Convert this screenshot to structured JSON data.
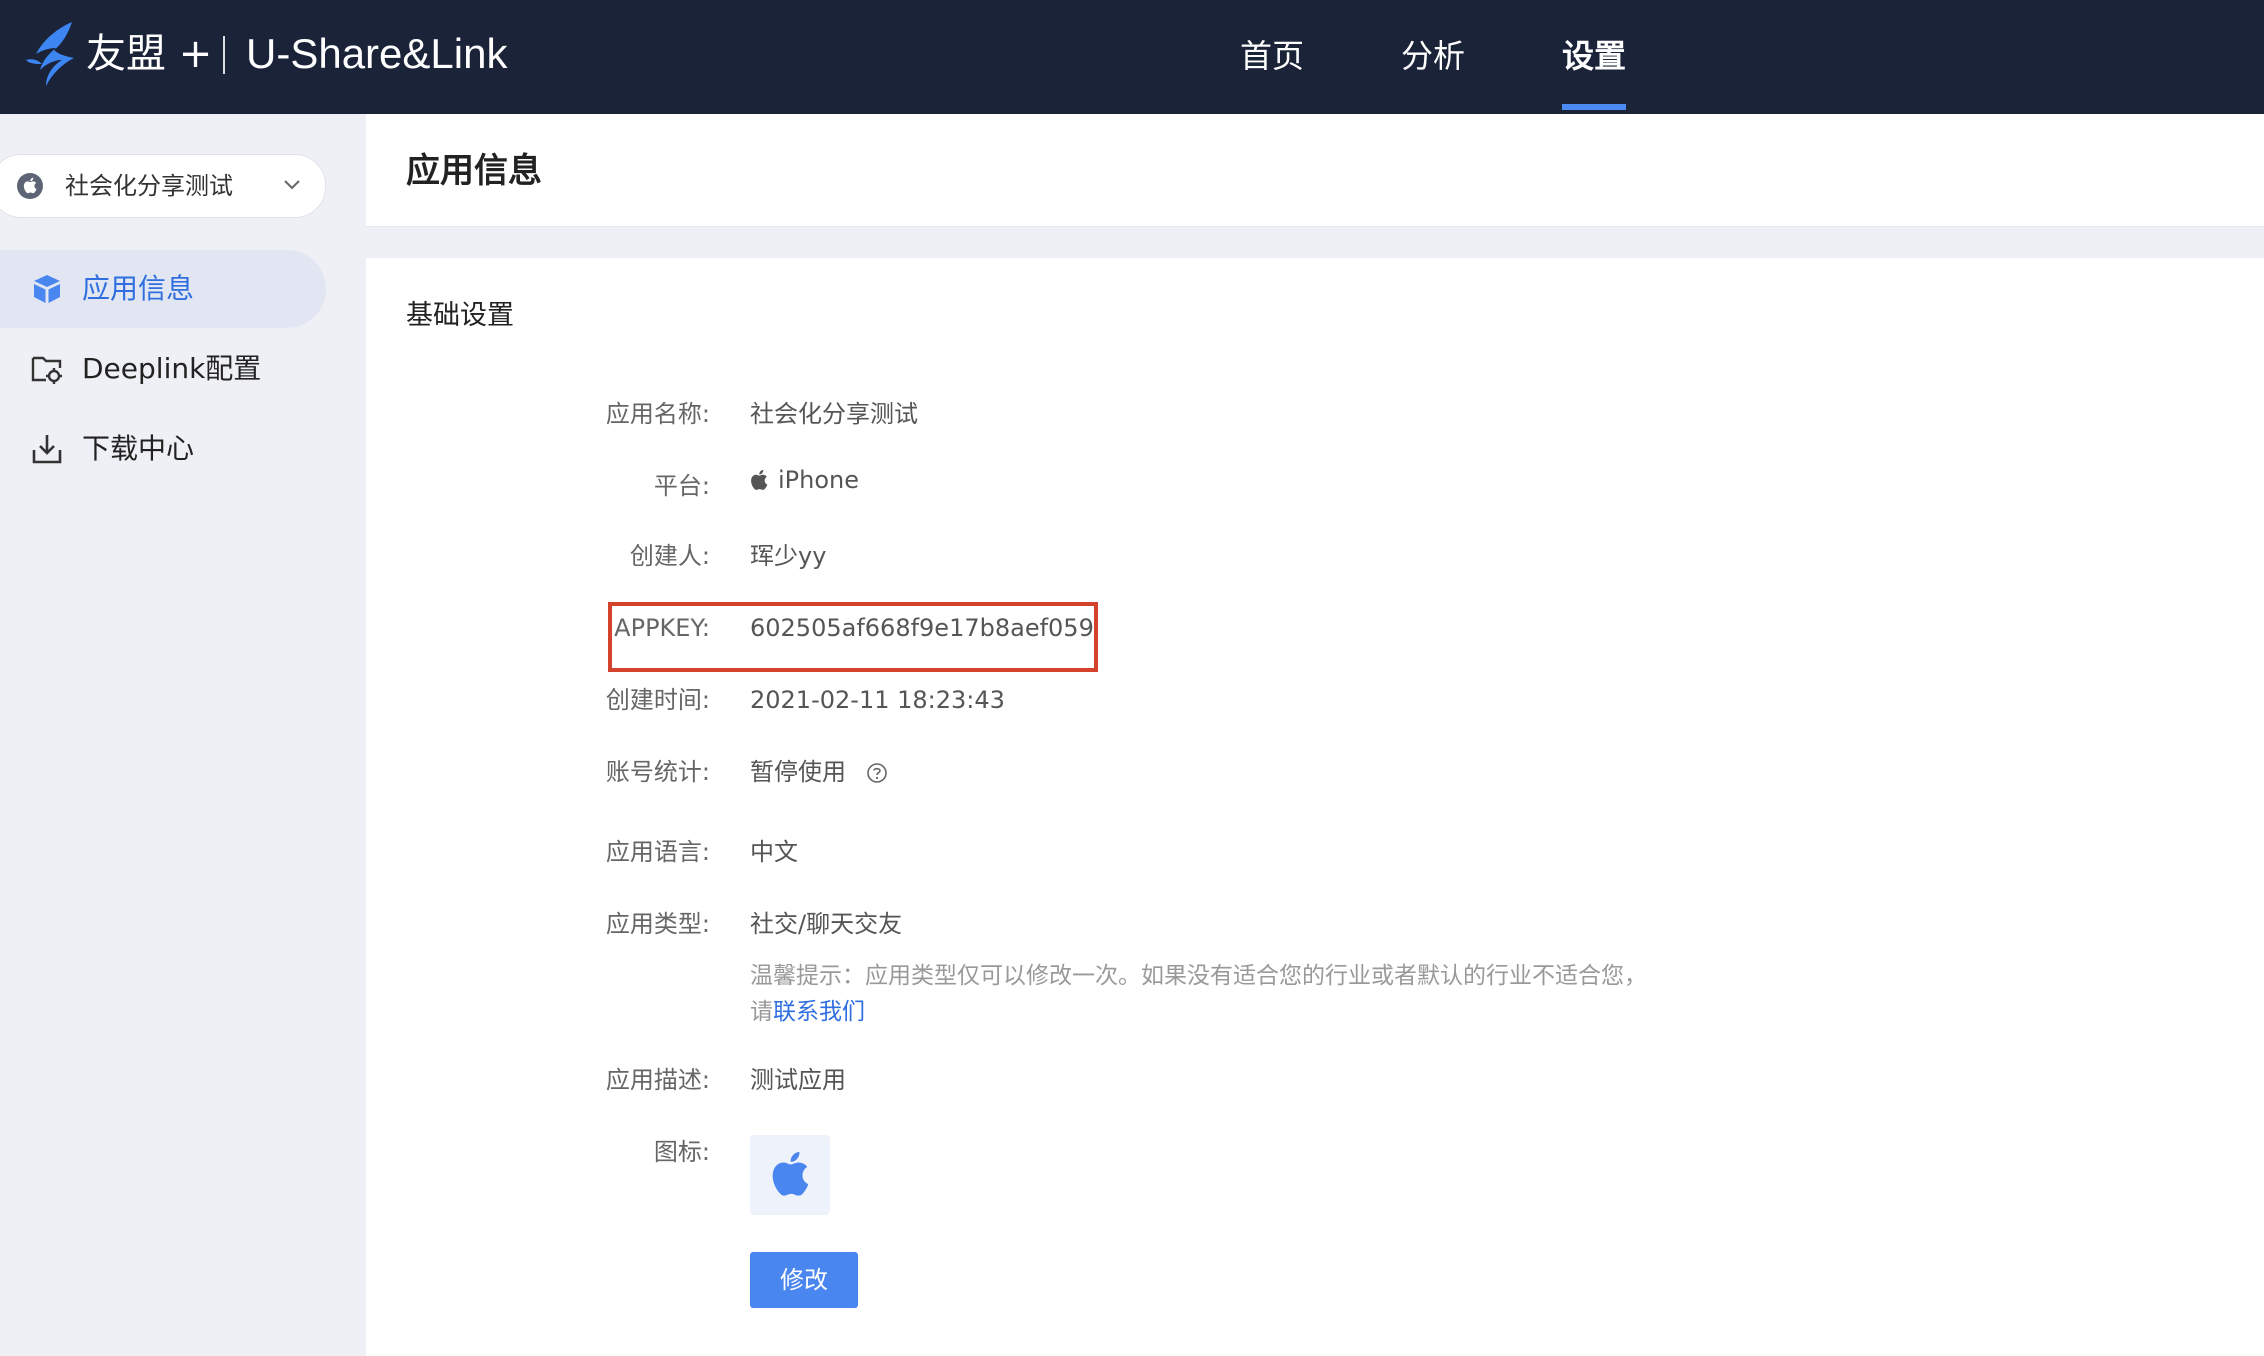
{
  "topbar": {
    "brand": "友盟 +",
    "product": "U-Share&Link",
    "nav": [
      {
        "label": "首页",
        "active": false
      },
      {
        "label": "分析",
        "active": false
      },
      {
        "label": "设置",
        "active": true
      }
    ],
    "accent_color": "#4c8bf5",
    "background_color": "#1b2339"
  },
  "sidebar": {
    "app_selector": {
      "label": "社会化分享测试",
      "icon": "apple-icon"
    },
    "items": [
      {
        "label": "应用信息",
        "icon": "cube-icon",
        "active": true
      },
      {
        "label": "Deeplink配置",
        "icon": "folder-gear-icon",
        "active": false
      },
      {
        "label": "下载中心",
        "icon": "download-icon",
        "active": false
      }
    ]
  },
  "header": {
    "title": "应用信息"
  },
  "main": {
    "section_title": "基础设置",
    "fields": {
      "app_name": {
        "label": "应用名称:",
        "value": "社会化分享测试"
      },
      "platform": {
        "label": "平台:",
        "value": "iPhone"
      },
      "creator": {
        "label": "创建人:",
        "value": "珲少yy"
      },
      "appkey": {
        "label": "APPKEY:",
        "value": "602505af668f9e17b8aef059"
      },
      "created_at": {
        "label": "创建时间:",
        "value": "2021-02-11 18:23:43"
      },
      "account_stats": {
        "label": "账号统计:",
        "value": "暂停使用"
      },
      "language": {
        "label": "应用语言:",
        "value": "中文"
      },
      "app_type": {
        "label": "应用类型:",
        "value": "社交/聊天交友"
      },
      "description": {
        "label": "应用描述:",
        "value": "测试应用"
      },
      "icon": {
        "label": "图标:"
      }
    },
    "tip": {
      "text": "温馨提示：应用类型仅可以修改一次。如果没有适合您的行业或者默认的行业不适合您，请",
      "link": "联系我们"
    },
    "edit_button": "修改"
  },
  "highlight_color": "#d4412d"
}
